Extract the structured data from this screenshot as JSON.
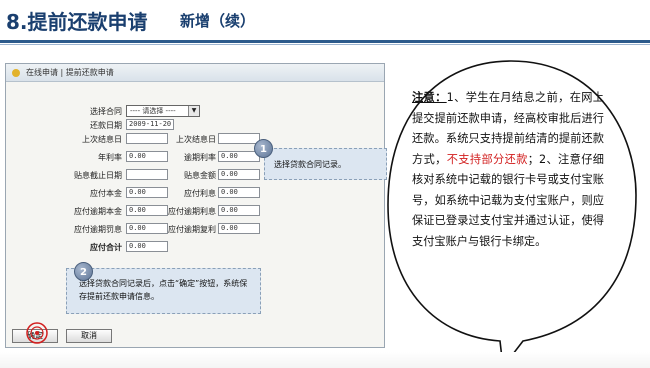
{
  "header": {
    "title": "8.提前还款申请",
    "subtitle": "新增（续）"
  },
  "form": {
    "breadcrumb": "在线申请 | 提前还款申请",
    "labels": {
      "contract": "选择合同",
      "repay_date": "还款日期",
      "last_repay_date": "上次结息日",
      "last_accrual_date": "上次结息日",
      "annual_rate": "年利率",
      "overdue_rate": "逾期利率",
      "accrued_till": "贴息截止日期",
      "interest_amount": "贴息金额",
      "principal_due": "应付本金",
      "interest_due": "应付利息",
      "penalty_principal": "应付逾期本金",
      "penalty_rate": "应付逾期利息",
      "penalty_overdue": "应付逾期罚息",
      "penalty_overdue_interest": "应付逾期复利",
      "total_due": "应付合计"
    },
    "values": {
      "contract": "---- 请选择 ----",
      "repay_date": "2009-11-20",
      "last_repay_date": "",
      "last_accrual_date": "",
      "annual_rate": "0.00",
      "overdue_rate": "0.00",
      "accrued_till": "",
      "interest_amount": "0.00",
      "principal_due": "0.00",
      "interest_due": "0.00",
      "penalty_principal": "0.00",
      "penalty_rate": "0.00",
      "penalty_overdue": "0.00",
      "penalty_overdue_interest": "0.00",
      "total_due": "0.00"
    },
    "buttons": {
      "confirm": "确定",
      "cancel": "取消"
    }
  },
  "callouts": {
    "one": {
      "num": "1",
      "text": "选择贷款合同记录。"
    },
    "two": {
      "num": "2",
      "text": "选择贷款合同记录后，点击“确定”按钮，系统保存提前还款申请信息。"
    }
  },
  "note": {
    "head": "注意：",
    "part1": "1、学生在月结息之前，在网上提交提前还款申请，经高校审批后进行还款。系统只支持提前结清的提前还款方式，",
    "red": "不支持部分还款",
    "part2": "；2、注意仔细核对系统中记载的银行卡号或支付宝账号，如系统中记载为支付宝账户，则应保证已登录过支付宝并通过认证，使得支付宝账户与银行卡绑定。"
  },
  "colors": {
    "accent": "#1a3f6f",
    "warning": "#d21f1f",
    "callout_bg": "#dce6f1"
  }
}
